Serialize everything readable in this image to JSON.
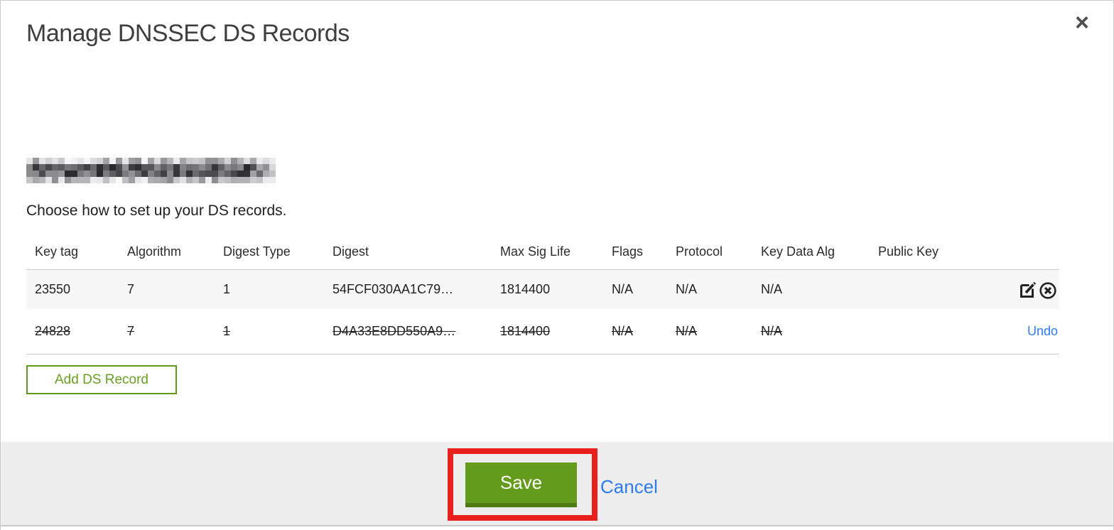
{
  "modal": {
    "title": "Manage DNSSEC DS Records",
    "subtitle": "Choose how to set up your DS records.",
    "domain_name_redacted": true,
    "close_icon": "×",
    "table": {
      "columns": [
        "Key tag",
        "Algorithm",
        "Digest Type",
        "Digest",
        "Max Sig Life",
        "Flags",
        "Protocol",
        "Key Data Alg",
        "Public Key"
      ],
      "rows": [
        {
          "key_tag": "23550",
          "algorithm": "7",
          "digest_type": "1",
          "digest": "54FCF030AA1C79…",
          "max_sig_life": "1814400",
          "flags": "N/A",
          "protocol": "N/A",
          "key_data_alg": "N/A",
          "public_key": "",
          "deleted": false,
          "actions": [
            "edit-icon",
            "delete-icon"
          ]
        },
        {
          "key_tag": "24828",
          "algorithm": "7",
          "digest_type": "1",
          "digest": "D4A33E8DD550A9…",
          "max_sig_life": "1814400",
          "flags": "N/A",
          "protocol": "N/A",
          "key_data_alg": "N/A",
          "public_key": "",
          "deleted": true,
          "undo_label": "Undo"
        }
      ]
    },
    "add_button_label": "Add DS Record",
    "footer": {
      "save_label": "Save",
      "cancel_label": "Cancel"
    }
  },
  "colors": {
    "accent_green": "#649b1c",
    "accent_green_dark": "#4d7a12",
    "outline_green": "#5f9a1d",
    "link_blue": "#2d7bf0",
    "annotation_red": "#e8211d",
    "row_alt_bg": "#f7f7f7",
    "footer_bg": "#ededed",
    "border_gray": "#c9c9c9",
    "title_gray": "#3e3e3e"
  }
}
